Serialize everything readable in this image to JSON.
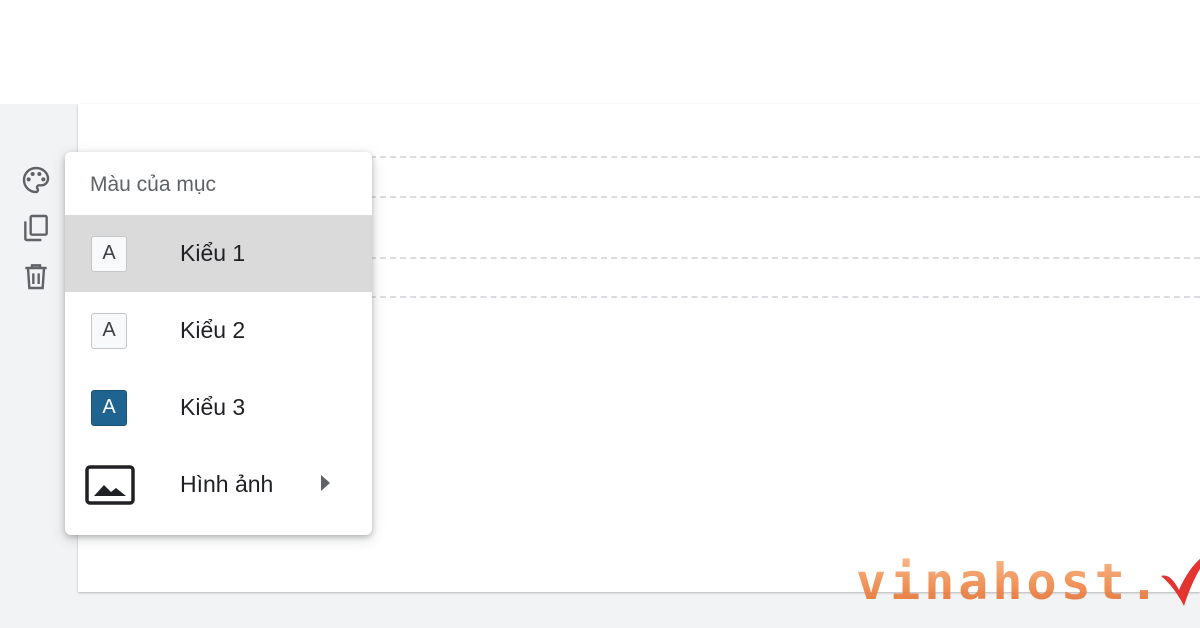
{
  "menu": {
    "title": "Màu của mục",
    "items": [
      {
        "label": "Kiểu 1",
        "swatch_letter": "A",
        "selected": true
      },
      {
        "label": "Kiểu 2",
        "swatch_letter": "A",
        "selected": false
      },
      {
        "label": "Kiểu 3",
        "swatch_letter": "A",
        "selected": false
      },
      {
        "label": "Hình ảnh",
        "icon": "image-icon",
        "has_submenu": true
      }
    ]
  },
  "toolbar": {
    "icons": [
      "palette-icon",
      "copy-icon",
      "trash-icon"
    ]
  },
  "watermark": {
    "text": "vinahost."
  },
  "colors": {
    "selected_row": "#dadada",
    "kieu3_swatch": "#1f6390",
    "watermark_orange": "#ef8a4c",
    "watermark_check": "#e3342f"
  }
}
